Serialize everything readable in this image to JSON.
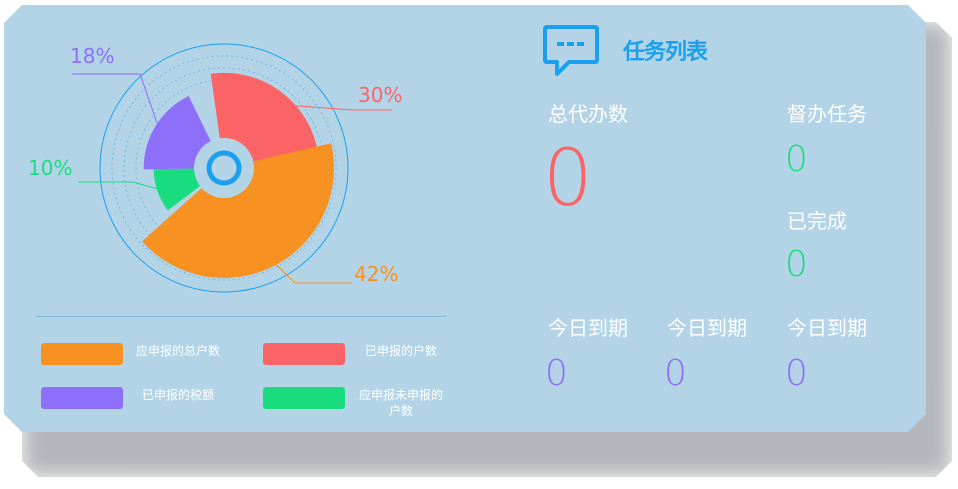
{
  "chart_data": {
    "type": "pie",
    "variant": "rose",
    "slices": [
      {
        "label": "应申报的总户数",
        "value": 42,
        "percent_label": "42%",
        "color": "#f79121"
      },
      {
        "label": "已申报的户数",
        "value": 30,
        "percent_label": "30%",
        "color": "#fb6466"
      },
      {
        "label": "已申报的税额",
        "value": 18,
        "percent_label": "18%",
        "color": "#8e6ff9"
      },
      {
        "label": "应申报未申报的户数",
        "value": 10,
        "percent_label": "10%",
        "color": "#18dc7d"
      }
    ],
    "legend_position": "bottom"
  },
  "legend": [
    {
      "label": "应申报的总户数",
      "color": "#f79121"
    },
    {
      "label": "已申报的户数",
      "color": "#fb6466"
    },
    {
      "label": "已申报的税额",
      "color": "#8e6ff9"
    },
    {
      "label": "应申报未申报的户数",
      "color": "#18dc7d"
    }
  ],
  "task_panel": {
    "title": "任务列表",
    "icon": "chat-bubble-icon",
    "total": {
      "label": "总代办数",
      "value": "0"
    },
    "supervise": {
      "label": "督办任务",
      "value": "0"
    },
    "completed": {
      "label": "已完成",
      "value": "0"
    },
    "due": [
      {
        "label": "今日到期",
        "value": "0"
      },
      {
        "label": "今日到期",
        "value": "0"
      },
      {
        "label": "今日到期",
        "value": "0"
      }
    ]
  },
  "colors": {
    "accent": "#1aa0ee",
    "total_value": "#fb6466",
    "green_value": "#18dc7d",
    "purple_value": "#8e6ff9",
    "panel_bg": "#b3d4e6"
  }
}
